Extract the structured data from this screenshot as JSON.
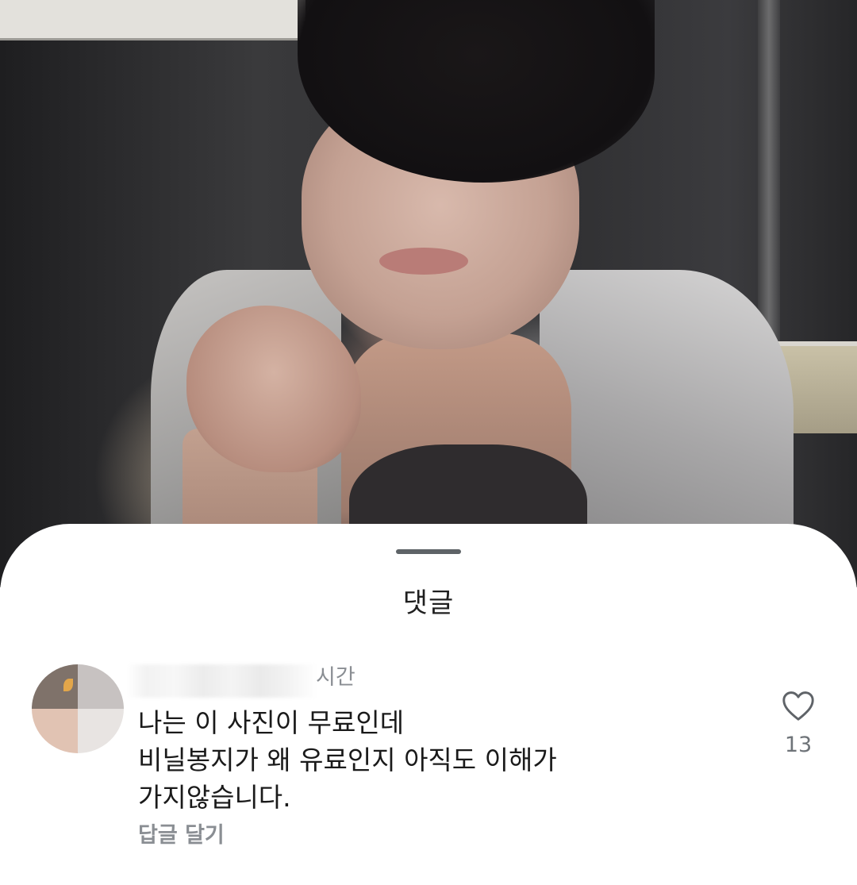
{
  "sheet": {
    "title": "댓글"
  },
  "comment": {
    "time": "시간",
    "body_lines": [
      "나는 이 사진이 무료인데",
      "비닐봉지가 왜 유료인지 아직도 이해가",
      "가지않습니다."
    ],
    "reply_label": "답글 달기",
    "like_count": "13",
    "like_icon": "heart-outline-icon"
  },
  "colors": {
    "handle": "#5e6367",
    "meta_text": "#8a8e93",
    "body_text": "#1a1a1a"
  }
}
